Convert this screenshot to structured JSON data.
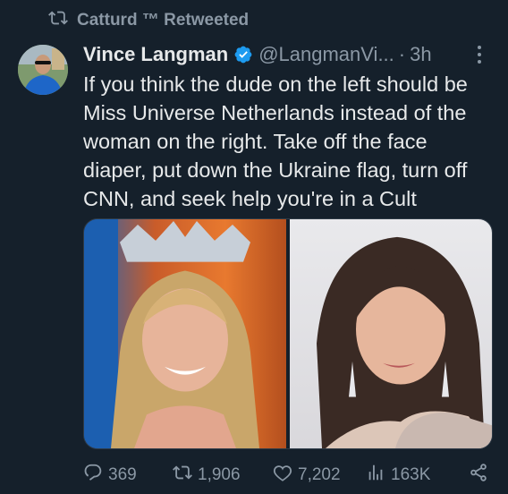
{
  "retweet_banner": {
    "text": "Catturd ™ Retweeted"
  },
  "author": {
    "name": "Vince Langman",
    "handle": "@LangmanVi...",
    "separator": "·",
    "time": "3h"
  },
  "tweet": {
    "text": "If you think the dude on the left should be Miss Universe Netherlands instead of the woman on the right. Take off the face diaper, put down the Ukraine flag, turn off CNN, and seek help you're in a Cult"
  },
  "media": [
    {
      "icon": "photo-left"
    },
    {
      "icon": "photo-right"
    }
  ],
  "actions": {
    "replies": "369",
    "retweets": "1,906",
    "likes": "7,202",
    "views": "163K"
  },
  "colors": {
    "background": "#15202b",
    "text": "#e7e9ea",
    "muted": "#8b98a5",
    "verified": "#1d9bf0"
  }
}
